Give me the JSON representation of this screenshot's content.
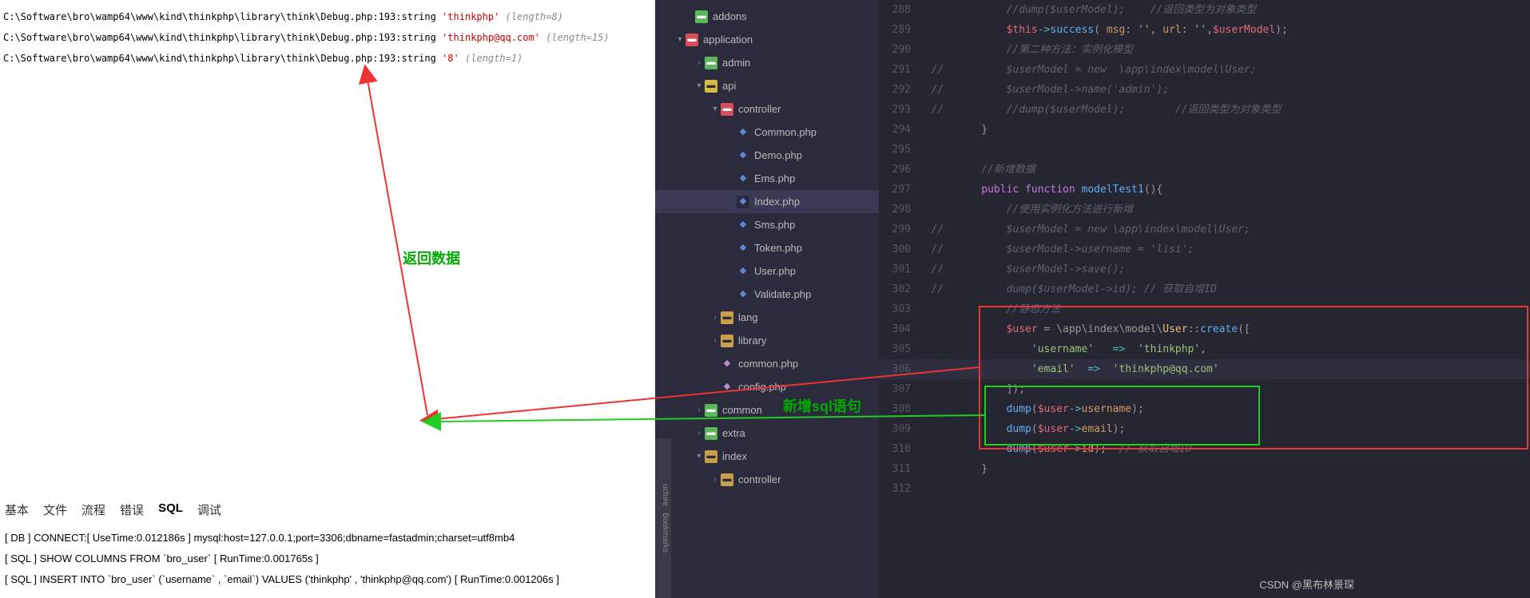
{
  "debug": {
    "lines": [
      {
        "path": "C:\\Software\\bro\\wamp64\\www\\kind\\thinkphp\\library\\think\\Debug.php:193:",
        "type": "string ",
        "value": "'thinkphp'",
        "len": " (length=8)"
      },
      {
        "path": "C:\\Software\\bro\\wamp64\\www\\kind\\thinkphp\\library\\think\\Debug.php:193:",
        "type": "string ",
        "value": "'thinkphp@qq.com'",
        "len": " (length=15)"
      },
      {
        "path": "C:\\Software\\bro\\wamp64\\www\\kind\\thinkphp\\library\\think\\Debug.php:193:",
        "type": "string ",
        "value": "'8'",
        "len": " (length=1)"
      }
    ]
  },
  "annotations": {
    "return_data": "返回数据",
    "new_sql": "新增sql语句"
  },
  "tabs": {
    "items": [
      "基本",
      "文件",
      "流程",
      "错误",
      "SQL",
      "调试"
    ],
    "active": "SQL"
  },
  "sql": {
    "lines": [
      "[ DB ] CONNECT:[ UseTime:0.012186s ] mysql:host=127.0.0.1;port=3306;dbname=fastadmin;charset=utf8mb4",
      "[ SQL ] SHOW COLUMNS FROM `bro_user` [ RunTime:0.001765s ]",
      "[ SQL ] INSERT INTO `bro_user` (`username` , `email`) VALUES ('thinkphp' , 'thinkphp@qq.com') [ RunTime:0.001206s ]"
    ]
  },
  "tree": {
    "items": [
      {
        "indent": 36,
        "chev": "",
        "icon": "folder-green",
        "label": "addons"
      },
      {
        "indent": 24,
        "chev": "▾",
        "icon": "folder-red",
        "label": "application"
      },
      {
        "indent": 48,
        "chev": "›",
        "icon": "folder-green",
        "label": "admin"
      },
      {
        "indent": 48,
        "chev": "▾",
        "icon": "folder-yellow",
        "label": "api"
      },
      {
        "indent": 68,
        "chev": "▾",
        "icon": "folder-red",
        "label": "controller"
      },
      {
        "indent": 88,
        "chev": "",
        "icon": "php",
        "label": "Common.php"
      },
      {
        "indent": 88,
        "chev": "",
        "icon": "php",
        "label": "Demo.php"
      },
      {
        "indent": 88,
        "chev": "",
        "icon": "php",
        "label": "Ems.php"
      },
      {
        "indent": 88,
        "chev": "",
        "icon": "php",
        "label": "Index.php",
        "sel": true
      },
      {
        "indent": 88,
        "chev": "",
        "icon": "php",
        "label": "Sms.php"
      },
      {
        "indent": 88,
        "chev": "",
        "icon": "php",
        "label": "Token.php"
      },
      {
        "indent": 88,
        "chev": "",
        "icon": "php",
        "label": "User.php"
      },
      {
        "indent": 88,
        "chev": "",
        "icon": "php",
        "label": "Validate.php"
      },
      {
        "indent": 68,
        "chev": "›",
        "icon": "folder",
        "label": "lang"
      },
      {
        "indent": 68,
        "chev": "›",
        "icon": "folder",
        "label": "library"
      },
      {
        "indent": 68,
        "chev": "",
        "icon": "php2",
        "label": "common.php"
      },
      {
        "indent": 68,
        "chev": "",
        "icon": "php2",
        "label": "config.php"
      },
      {
        "indent": 48,
        "chev": "›",
        "icon": "folder-green",
        "label": "common"
      },
      {
        "indent": 48,
        "chev": "›",
        "icon": "folder-green",
        "label": "extra"
      },
      {
        "indent": 48,
        "chev": "▾",
        "icon": "folder",
        "label": "index"
      },
      {
        "indent": 68,
        "chev": "›",
        "icon": "folder",
        "label": "controller"
      }
    ]
  },
  "code": {
    "start": 288,
    "lines": [
      {
        "n": 288,
        "html": "            <span class='cm'>//dump($userModel);    //返回类型为对象类型</span>"
      },
      {
        "n": 289,
        "html": "            <span class='var'>$this</span><span class='op'>-&gt;</span><span class='fn'>success</span>( <span class='prop'>msg:</span> <span class='str'>''</span>, <span class='prop'>url:</span> <span class='str'>''</span>,<span class='var'>$userModel</span>);"
      },
      {
        "n": 290,
        "html": "            <span class='cm'>//第二种方法：实例化模型</span>"
      },
      {
        "n": 291,
        "html": "<span class='cm'>//          $userModel = new  \\app\\index\\model\\User;</span>"
      },
      {
        "n": 292,
        "html": "<span class='cm'>//          $userModel-&gt;name('admin');</span>"
      },
      {
        "n": 293,
        "html": "<span class='cm'>//          //dump($userModel);        //返回类型为对象类型</span>"
      },
      {
        "n": 294,
        "html": "        }"
      },
      {
        "n": 295,
        "html": ""
      },
      {
        "n": 296,
        "html": "        <span class='cm'>//新增数据</span>"
      },
      {
        "n": 297,
        "html": "        <span class='kw'>public</span> <span class='kw'>function</span> <span class='fn'>modelTest1</span>(){"
      },
      {
        "n": 298,
        "html": "            <span class='cm'>//使用实例化方法进行新增</span>"
      },
      {
        "n": 299,
        "html": "<span class='cm'>//          $userModel = new \\app\\index\\model\\User;</span>"
      },
      {
        "n": 300,
        "html": "<span class='cm'>//          $userModel-&gt;username = 'lisi';</span>"
      },
      {
        "n": 301,
        "html": "<span class='cm'>//          $userModel-&gt;save();</span>"
      },
      {
        "n": 302,
        "html": "<span class='cm'>//          dump($userModel-&gt;id); // 获取自增ID</span>"
      },
      {
        "n": 303,
        "html": "            <span class='cm'>//静态方法</span>"
      },
      {
        "n": 304,
        "html": "            <span class='var'>$user</span> = \\app\\index\\model\\<span class='this'>User</span>::<span class='fn'>create</span>(["
      },
      {
        "n": 305,
        "html": "                <span class='str'>'username'</span>   <span class='op'>=&gt;</span>  <span class='str'>'thinkphp'</span>,"
      },
      {
        "n": 306,
        "html": "                <span class='str'>'email'</span>  <span class='op'>=&gt;</span>  <span class='str'>'thinkphp@qq.com'</span>",
        "cur": true
      },
      {
        "n": 307,
        "html": "            ]);"
      },
      {
        "n": 308,
        "html": "            <span class='fn'>dump</span>(<span class='var'>$user</span><span class='op'>-&gt;</span><span class='prop'>username</span>);"
      },
      {
        "n": 309,
        "html": "            <span class='fn'>dump</span>(<span class='var'>$user</span><span class='op'>-&gt;</span><span class='prop'>email</span>);"
      },
      {
        "n": 310,
        "html": "            <span class='fn'>dump</span>(<span class='var'>$user</span><span class='op'>-&gt;</span><span class='prop'>id</span>);  <span class='cm'>// 获取自增ID</span>"
      },
      {
        "n": 311,
        "html": "        }"
      },
      {
        "n": 312,
        "html": ""
      }
    ]
  },
  "side": {
    "bookmarks": "Bookmarks",
    "structure": "ucture"
  },
  "watermark": "CSDN @黑布林景琛"
}
